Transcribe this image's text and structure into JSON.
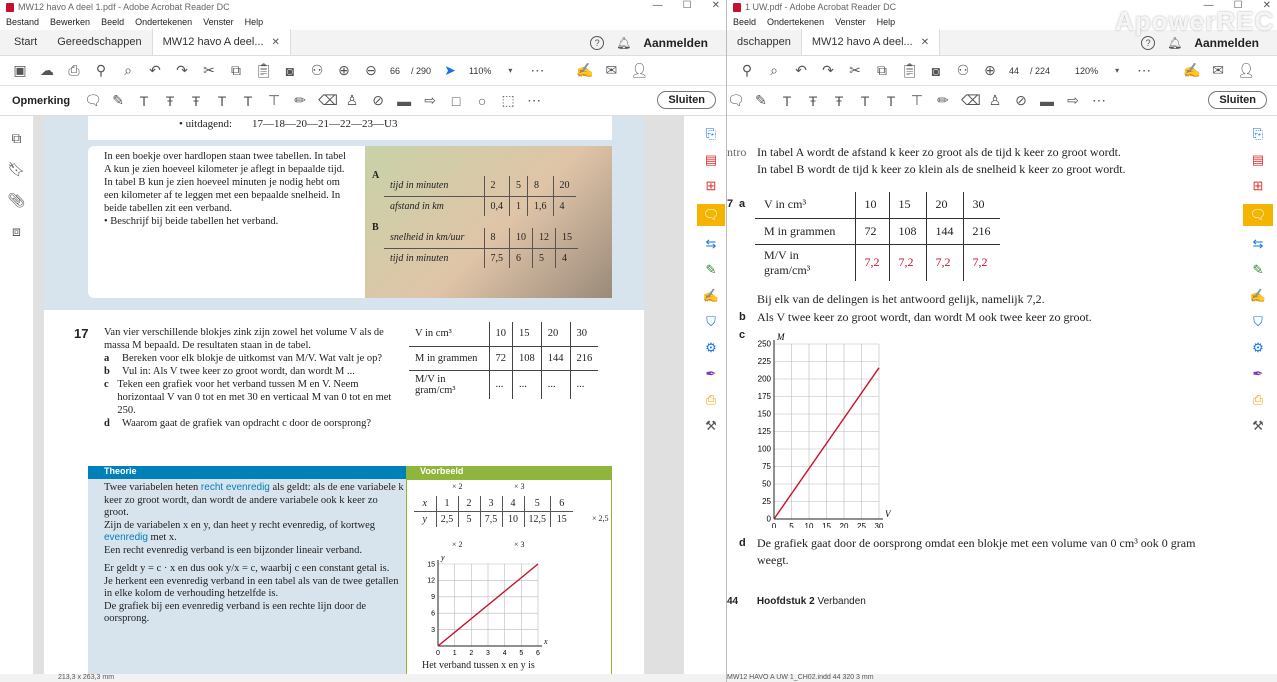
{
  "left_window": {
    "title": "MW12 havo A deel 1.pdf - Adobe Acrobat Reader DC",
    "menu": [
      "Bestand",
      "Bewerken",
      "Beeld",
      "Ondertekenen",
      "Venster",
      "Help"
    ],
    "tabs": {
      "home": "Start",
      "tools": "Gereedschappen",
      "doc": "MW12 havo A deel..."
    },
    "signin": "Aanmelden",
    "page_current": "66",
    "page_total": "/ 290",
    "zoom": "110%",
    "annot_label": "Opmerking",
    "close_label": "Sluiten",
    "status": "213,3 x 263,3 mm",
    "content": {
      "list_head": "• uitdagend:",
      "list_vals": "17—18—20—21—22—23—U3",
      "intro": "In een boekje over hardlopen staan twee tabellen. In tabel A kun je zien hoeveel kilometer je aflegt in bepaalde tijd. In tabel B kun je zien hoeveel minuten je nodig hebt om een kilometer af te leggen met een bepaalde snelheid. In beide tabellen zit een verband.",
      "intro_q": "• Beschrijf bij beide tabellen het verband.",
      "tableA_label": "A",
      "tableA": [
        [
          "tijd in minuten",
          "2",
          "5",
          "8",
          "20"
        ],
        [
          "afstand in km",
          "0,4",
          "1",
          "1,6",
          "4"
        ]
      ],
      "tableB_label": "B",
      "tableB": [
        [
          "snelheid in km/uur",
          "8",
          "10",
          "12",
          "15"
        ],
        [
          "tijd in minuten",
          "7,5",
          "6",
          "5",
          "4"
        ]
      ],
      "q17_num": "17",
      "q17_intro": "Van vier verschillende blokjes zink zijn zowel het volume V als de massa M bepaald. De resultaten staan in de tabel.",
      "q17_items": [
        {
          "l": "a",
          "t": "Bereken voor elk blokje de uitkomst van M/V. Wat valt je op?"
        },
        {
          "l": "b",
          "t": "Vul in: Als V twee keer zo groot wordt, dan wordt M ..."
        },
        {
          "l": "c",
          "t": "Teken een grafiek voor het verband tussen M en V. Neem horizontaal V van 0 tot en met 30 en verticaal M van 0 tot en met 250."
        },
        {
          "l": "d",
          "t": "Waarom gaat de grafiek van opdracht c door de oorsprong?"
        }
      ],
      "q17_table": [
        [
          "V in cm³",
          "10",
          "15",
          "20",
          "30"
        ],
        [
          "M in grammen",
          "72",
          "108",
          "144",
          "216"
        ],
        [
          "M/V in gram/cm³",
          "...",
          "...",
          "...",
          "..."
        ]
      ],
      "theory_head": "Theorie",
      "theory_p1_a": "Twee variabelen heten ",
      "theory_p1_b": "recht evenredig",
      "theory_p1_c": " als geldt: als de ene variabele k keer zo groot wordt, dan wordt de andere variabele ook k keer zo groot.",
      "theory_p2_a": "Zijn de variabelen x en y, dan heet y recht evenredig, of kortweg ",
      "theory_p2_b": "evenredig",
      "theory_p2_c": " met x.",
      "theory_p3": "Een recht evenredig verband is een bijzonder lineair verband.",
      "theory_p4": "Er geldt y = c · x en dus ook y/x = c, waarbij c een constant getal is.",
      "theory_p5": "Je herkent een evenredig verband in een tabel als van de twee getallen in elke kolom de verhouding hetzelfde is.",
      "theory_p6": "De grafiek bij een evenredig verband is een rechte lijn door de oorsprong.",
      "example_head": "Voorbeeld",
      "example_table": [
        [
          "x",
          "1",
          "2",
          "3",
          "4",
          "5",
          "6"
        ],
        [
          "y",
          "2,5",
          "5",
          "7,5",
          "10",
          "12,5",
          "15"
        ]
      ],
      "example_x2": "× 2",
      "example_x3": "× 3",
      "example_x25": "× 2,5",
      "example_caption": "Het verband tussen x en y is"
    }
  },
  "right_window": {
    "title": "1 UW.pdf - Adobe Acrobat Reader DC",
    "menu": [
      "Beeld",
      "Ondertekenen",
      "Venster",
      "Help"
    ],
    "tabs": {
      "tools": "dschappen",
      "doc": "MW12 havo A deel..."
    },
    "signin": "Aanmelden",
    "page_current": "44",
    "page_total": "/ 224",
    "zoom": "120%",
    "close_label": "Sluiten",
    "status": "MW12 HAVO A UW 1_CH02.indd   44",
    "status2": "320 3 mm",
    "content": {
      "intro_label": "ntro",
      "intro_l1": "In tabel A wordt de afstand k keer zo groot als de tijd k keer zo groot wordt.",
      "intro_l2": "In tabel B wordt de tijd k keer zo klein als de snelheid k keer zo groot wordt.",
      "q_num": "7",
      "q_a": "a",
      "table": [
        [
          "V in cm³",
          "10",
          "15",
          "20",
          "30"
        ],
        [
          "M in grammen",
          "72",
          "108",
          "144",
          "216"
        ],
        [
          "M/V in gram/cm³",
          "7,2",
          "7,2",
          "7,2",
          "7,2"
        ]
      ],
      "ans_a": "Bij elk van de delingen is het antwoord gelijk, namelijk 7,2.",
      "q_b": "b",
      "ans_b": "Als V twee keer zo groot wordt, dan wordt M ook twee keer zo groot.",
      "q_c": "c",
      "q_d": "d",
      "ans_d": "De grafiek gaat door de oorsprong omdat een blokje met een volume van 0 cm³ ook 0 gram weegt.",
      "footer_page": "44",
      "footer_chapter": "Hoofdstuk 2",
      "footer_title": "Verbanden"
    }
  },
  "watermark": "ApowerREC",
  "chart_data": [
    {
      "type": "line",
      "xlabel": "V",
      "ylabel": "M",
      "x": [
        0,
        30
      ],
      "series": [
        {
          "values": [
            0,
            216
          ]
        }
      ],
      "xlim": [
        0,
        30
      ],
      "ylim": [
        0,
        250
      ],
      "xticks": [
        0,
        5,
        10,
        15,
        20,
        25,
        30
      ],
      "yticks": [
        0,
        25,
        50,
        75,
        100,
        125,
        150,
        175,
        200,
        225,
        250
      ],
      "grid": true,
      "color": "#c8102e"
    },
    {
      "type": "line",
      "xlabel": "x",
      "ylabel": "y",
      "x": [
        0,
        6
      ],
      "series": [
        {
          "values": [
            0,
            15
          ]
        }
      ],
      "xlim": [
        0,
        6
      ],
      "ylim": [
        0,
        15
      ],
      "xticks": [
        0,
        1,
        2,
        3,
        4,
        5,
        6
      ],
      "yticks": [
        3,
        6,
        9,
        12,
        15
      ],
      "grid": true,
      "color": "#c8102e"
    }
  ]
}
